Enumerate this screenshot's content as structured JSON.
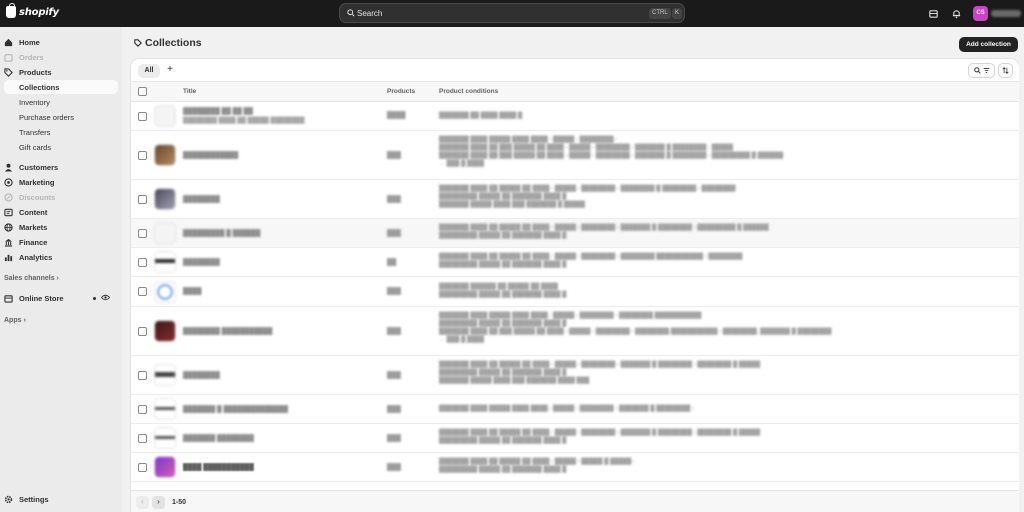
{
  "topbar": {
    "logo_text": "shopify",
    "search_placeholder": "Search",
    "shortcut_ctrl": "CTRL",
    "shortcut_k": "K",
    "avatar_initials": "CS"
  },
  "sidebar": {
    "items": [
      {
        "label": "Home",
        "icon": "home-icon",
        "state": "normal"
      },
      {
        "label": "Orders",
        "icon": "orders-icon",
        "state": "dim"
      },
      {
        "label": "Products",
        "icon": "tag-icon",
        "state": "normal"
      },
      {
        "label": "Customers",
        "icon": "person-icon",
        "state": "normal"
      },
      {
        "label": "Marketing",
        "icon": "target-icon",
        "state": "normal"
      },
      {
        "label": "Discounts",
        "icon": "discount-icon",
        "state": "dim"
      },
      {
        "label": "Content",
        "icon": "content-icon",
        "state": "normal"
      },
      {
        "label": "Markets",
        "icon": "globe-icon",
        "state": "normal"
      },
      {
        "label": "Finance",
        "icon": "bank-icon",
        "state": "normal"
      },
      {
        "label": "Analytics",
        "icon": "chart-icon",
        "state": "normal"
      }
    ],
    "products_sub": [
      "Collections",
      "Inventory",
      "Purchase orders",
      "Transfers",
      "Gift cards"
    ],
    "sales_channels": "Sales channels",
    "online_store": "Online Store",
    "apps": "Apps",
    "settings": "Settings"
  },
  "page": {
    "title": "Collections",
    "add_button": "Add collection",
    "tab_all": "All",
    "tab_add": "+"
  },
  "table": {
    "headers": {
      "title": "Title",
      "products": "Products",
      "conditions": "Product conditions"
    }
  },
  "pagination": {
    "prev": "‹",
    "next": "›",
    "range": "1-50"
  },
  "colors": {
    "topbar": "#1a1a1a",
    "sidebar": "#ebebeb",
    "primary_button": "#222222",
    "avatar": "#d040c8"
  }
}
